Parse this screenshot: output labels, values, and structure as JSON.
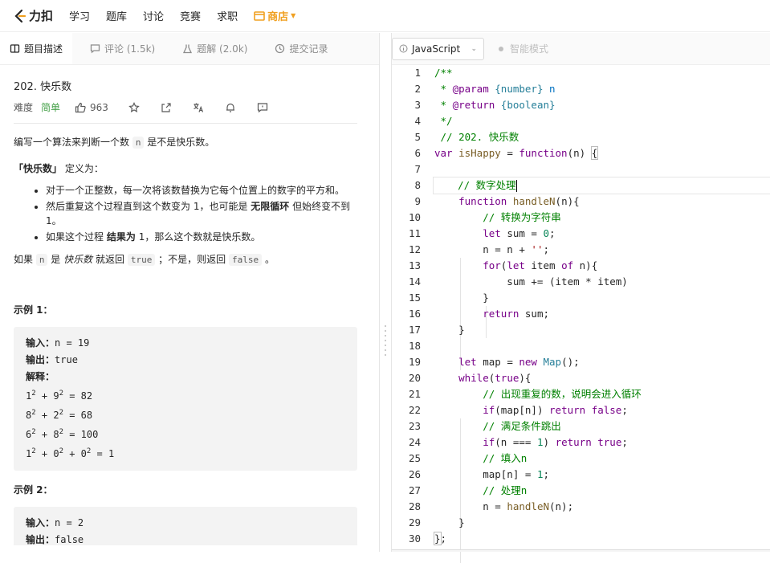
{
  "app": {
    "logo_text": "力扣",
    "nav": [
      "学习",
      "题库",
      "讨论",
      "竞赛",
      "求职"
    ],
    "store_label": "商店"
  },
  "tabs": [
    {
      "label": "题目描述",
      "icon": "book-icon",
      "active": true
    },
    {
      "label": "评论 (1.5k)",
      "icon": "comment-icon",
      "active": false
    },
    {
      "label": "题解 (2.0k)",
      "icon": "flask-icon",
      "active": false
    },
    {
      "label": "提交记录",
      "icon": "clock-icon",
      "active": false
    }
  ],
  "problem": {
    "title": "202. 快乐数",
    "difficulty_label": "难度",
    "difficulty": "简单",
    "likes": "963",
    "intro_a": "编写一个算法来判断一个数",
    "intro_n": "n",
    "intro_b": "是不是快乐数。",
    "def_term": "「快乐数」",
    "def_rest": "定义为：",
    "rule1": "对于一个正整数，每一次将该数替换为它每个位置上的数字的平方和。",
    "rule2_a": "然后重复这个过程直到这个数变为 1，也可能是",
    "rule2_b": "无限循环",
    "rule2_c": "但始终变不到 1。",
    "rule3_a": "如果这个过程",
    "rule3_b": "结果为",
    "rule3_c": "1，那么这个数就是快乐数。",
    "ret_a": "如果",
    "ret_n": "n",
    "ret_b": "是",
    "ret_c": "快乐数",
    "ret_d": "就返回",
    "ret_true": "true",
    "ret_e": "；不是，则返回",
    "ret_false": "false",
    "ret_f": "。",
    "ex1_title": "示例 1：",
    "ex1_in_label": "输入：",
    "ex1_in": "n = 19",
    "ex1_out_label": "输出：",
    "ex1_out": "true",
    "ex1_exp_label": "解释：",
    "ex2_title": "示例 2：",
    "ex2_in_label": "输入：",
    "ex2_in": "n = 2",
    "ex2_out_label": "输出：",
    "ex2_out": "false"
  },
  "editor": {
    "language": "JavaScript",
    "smart_mode": "智能模式",
    "line_numbers": [
      "1",
      "2",
      "3",
      "4",
      "5",
      "6",
      "7",
      "8",
      "9",
      "10",
      "11",
      "12",
      "13",
      "14",
      "15",
      "16",
      "17",
      "18",
      "19",
      "20",
      "21",
      "22",
      "23",
      "24",
      "25",
      "26",
      "27",
      "28",
      "29",
      "30"
    ]
  }
}
